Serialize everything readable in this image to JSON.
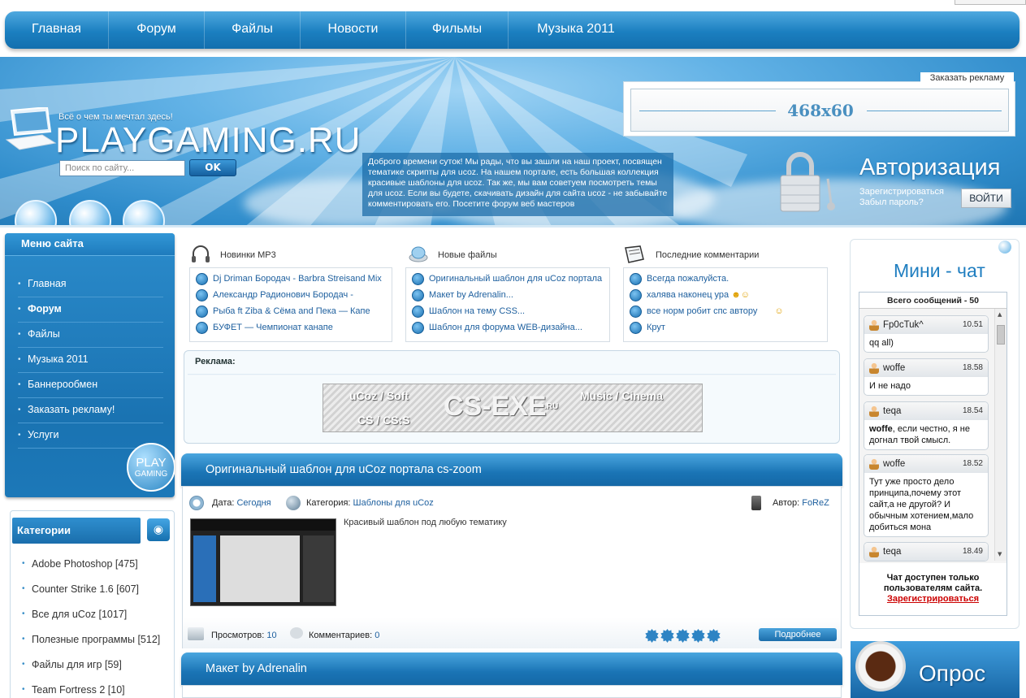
{
  "nav": [
    "Главная",
    "Форум",
    "Файлы",
    "Новости",
    "Фильмы",
    "Музыка 2011"
  ],
  "header": {
    "slogan": "Всё о чем ты мечтал здесь!",
    "site_name": "PLAYGAMING.RU",
    "search_placeholder": "Поиск по сайту...",
    "search_button": "OK",
    "welcome_text": "Доброго времени суток! Мы рады, что вы зашли на наш проект, посвящен тематике скрипты для ucoz. На нашем портале, есть большая коллекция красивые шаблоны для ucoz. Так же, мы вам советуем посмотреть темы для ucoz. Если вы будете, скачивать дизайн для сайта ucoz - не забывайте комментировать его. Посетите форум веб мастеров",
    "order_ad": "Заказать рекламу",
    "banner_size": "468x60",
    "auth_title": "Авторизация",
    "register_link": "Зарегистрироваться",
    "forgot_link": "Забыл пароль?",
    "login_button": "ВОЙТИ"
  },
  "menu": {
    "title": "Меню сайта",
    "items": [
      "Главная",
      "Форум",
      "Файлы",
      "Музыка 2011",
      "Баннерообмен",
      "Заказать рекламу!",
      "Услуги"
    ],
    "logo_line1": "PLAY",
    "logo_line2": "GAMING"
  },
  "categories": {
    "title": "Категории",
    "items": [
      "Adobe Photoshop [475]",
      "Counter Strike 1.6 [607]",
      "Все для uCoz [1017]",
      "Полезные программы [512]",
      "Файлы для игр [59]",
      "Team Fortress 2 [10]"
    ]
  },
  "blocks": {
    "mp3": {
      "title": "Новинки MP3",
      "items": [
        "Dj Driman Бородач - Barbra Streisand Mix",
        "Александр Радионович Бородач -",
        "Рыба ft Ziba & Сёма and Пека — Капе",
        "БУФЕТ — Чемпионат канапе"
      ]
    },
    "files": {
      "title": "Новые файлы",
      "items": [
        "Оригинальный шаблон для uCoz портала",
        "Макет by Adrenalin...",
        "Шаблон на тему CSS...",
        "Шаблон для форума WEB-дизайна..."
      ]
    },
    "comments": {
      "title": "Последние комментарии",
      "items": [
        "Всегда пожалуйста.",
        "халява наконец ура",
        "все норм робит спс автору",
        "Крут"
      ]
    }
  },
  "ads": {
    "title": "Реклама:",
    "banner": {
      "left_top": "uCoz / Soft",
      "left_bottom": "CS / CS:S",
      "center": "CS-EXE",
      "center_suffix": ".RU",
      "right": "Music / Cinema"
    }
  },
  "posts": [
    {
      "title": "Оригинальный шаблон для uCoz портала cs-zoom",
      "date_label": "Дата:",
      "date": "Сегодня",
      "category_label": "Категория:",
      "category": "Шаблоны для uCoz",
      "author_label": "Автор:",
      "author": "FoReZ",
      "description": "Красивый шаблон под любую тематику",
      "views_label": "Просмотров:",
      "views": "10",
      "comments_label": "Комментариев:",
      "comments": "0",
      "rating": 5,
      "more": "Подробнее"
    },
    {
      "title": "Макет by Adrenalin"
    }
  ],
  "chat": {
    "title": "Мини - чат",
    "count_label": "Всего сообщений - 50",
    "messages": [
      {
        "user": "Fp0cTuk^",
        "time": "10.51",
        "text": "qq all)"
      },
      {
        "user": "woffe",
        "time": "18.58",
        "text": "И не надо"
      },
      {
        "user": "teqa",
        "time": "18.54",
        "text_bold": "woffe",
        "text": ", если честно, я не догнал твой смысл."
      },
      {
        "user": "woffe",
        "time": "18.52",
        "text": "Тут уже просто дело принципа,почему этот сайт,а не другой? И обычным хотением,мало добиться мона"
      },
      {
        "user": "teqa",
        "time": "18.49",
        "text": ""
      }
    ],
    "footer": "Чат доступен только пользователям сайта.",
    "register": "Зарегистрироваться"
  },
  "poll": {
    "title": "Опрос"
  },
  "colors": {
    "primary": "#1a74b5",
    "link": "#1d5f9e",
    "header_light": "#62b2e6"
  }
}
